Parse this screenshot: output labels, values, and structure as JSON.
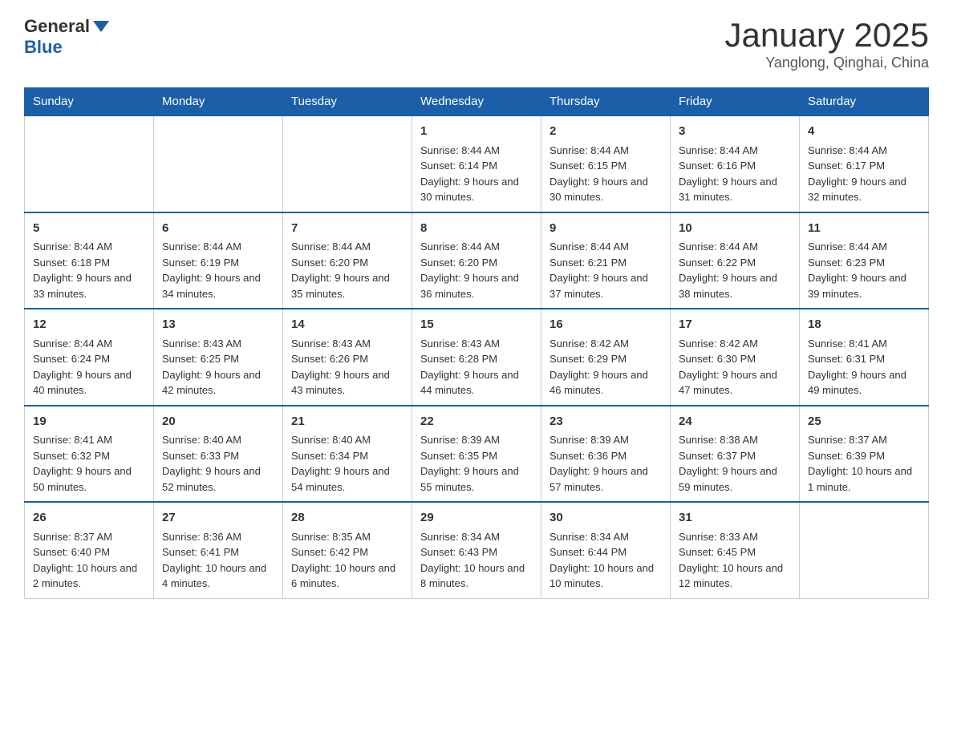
{
  "header": {
    "logo_general": "General",
    "logo_blue": "Blue",
    "month_title": "January 2025",
    "location": "Yanglong, Qinghai, China"
  },
  "weekdays": [
    "Sunday",
    "Monday",
    "Tuesday",
    "Wednesday",
    "Thursday",
    "Friday",
    "Saturday"
  ],
  "weeks": [
    [
      {
        "day": "",
        "info": ""
      },
      {
        "day": "",
        "info": ""
      },
      {
        "day": "",
        "info": ""
      },
      {
        "day": "1",
        "info": "Sunrise: 8:44 AM\nSunset: 6:14 PM\nDaylight: 9 hours and 30 minutes."
      },
      {
        "day": "2",
        "info": "Sunrise: 8:44 AM\nSunset: 6:15 PM\nDaylight: 9 hours and 30 minutes."
      },
      {
        "day": "3",
        "info": "Sunrise: 8:44 AM\nSunset: 6:16 PM\nDaylight: 9 hours and 31 minutes."
      },
      {
        "day": "4",
        "info": "Sunrise: 8:44 AM\nSunset: 6:17 PM\nDaylight: 9 hours and 32 minutes."
      }
    ],
    [
      {
        "day": "5",
        "info": "Sunrise: 8:44 AM\nSunset: 6:18 PM\nDaylight: 9 hours and 33 minutes."
      },
      {
        "day": "6",
        "info": "Sunrise: 8:44 AM\nSunset: 6:19 PM\nDaylight: 9 hours and 34 minutes."
      },
      {
        "day": "7",
        "info": "Sunrise: 8:44 AM\nSunset: 6:20 PM\nDaylight: 9 hours and 35 minutes."
      },
      {
        "day": "8",
        "info": "Sunrise: 8:44 AM\nSunset: 6:20 PM\nDaylight: 9 hours and 36 minutes."
      },
      {
        "day": "9",
        "info": "Sunrise: 8:44 AM\nSunset: 6:21 PM\nDaylight: 9 hours and 37 minutes."
      },
      {
        "day": "10",
        "info": "Sunrise: 8:44 AM\nSunset: 6:22 PM\nDaylight: 9 hours and 38 minutes."
      },
      {
        "day": "11",
        "info": "Sunrise: 8:44 AM\nSunset: 6:23 PM\nDaylight: 9 hours and 39 minutes."
      }
    ],
    [
      {
        "day": "12",
        "info": "Sunrise: 8:44 AM\nSunset: 6:24 PM\nDaylight: 9 hours and 40 minutes."
      },
      {
        "day": "13",
        "info": "Sunrise: 8:43 AM\nSunset: 6:25 PM\nDaylight: 9 hours and 42 minutes."
      },
      {
        "day": "14",
        "info": "Sunrise: 8:43 AM\nSunset: 6:26 PM\nDaylight: 9 hours and 43 minutes."
      },
      {
        "day": "15",
        "info": "Sunrise: 8:43 AM\nSunset: 6:28 PM\nDaylight: 9 hours and 44 minutes."
      },
      {
        "day": "16",
        "info": "Sunrise: 8:42 AM\nSunset: 6:29 PM\nDaylight: 9 hours and 46 minutes."
      },
      {
        "day": "17",
        "info": "Sunrise: 8:42 AM\nSunset: 6:30 PM\nDaylight: 9 hours and 47 minutes."
      },
      {
        "day": "18",
        "info": "Sunrise: 8:41 AM\nSunset: 6:31 PM\nDaylight: 9 hours and 49 minutes."
      }
    ],
    [
      {
        "day": "19",
        "info": "Sunrise: 8:41 AM\nSunset: 6:32 PM\nDaylight: 9 hours and 50 minutes."
      },
      {
        "day": "20",
        "info": "Sunrise: 8:40 AM\nSunset: 6:33 PM\nDaylight: 9 hours and 52 minutes."
      },
      {
        "day": "21",
        "info": "Sunrise: 8:40 AM\nSunset: 6:34 PM\nDaylight: 9 hours and 54 minutes."
      },
      {
        "day": "22",
        "info": "Sunrise: 8:39 AM\nSunset: 6:35 PM\nDaylight: 9 hours and 55 minutes."
      },
      {
        "day": "23",
        "info": "Sunrise: 8:39 AM\nSunset: 6:36 PM\nDaylight: 9 hours and 57 minutes."
      },
      {
        "day": "24",
        "info": "Sunrise: 8:38 AM\nSunset: 6:37 PM\nDaylight: 9 hours and 59 minutes."
      },
      {
        "day": "25",
        "info": "Sunrise: 8:37 AM\nSunset: 6:39 PM\nDaylight: 10 hours and 1 minute."
      }
    ],
    [
      {
        "day": "26",
        "info": "Sunrise: 8:37 AM\nSunset: 6:40 PM\nDaylight: 10 hours and 2 minutes."
      },
      {
        "day": "27",
        "info": "Sunrise: 8:36 AM\nSunset: 6:41 PM\nDaylight: 10 hours and 4 minutes."
      },
      {
        "day": "28",
        "info": "Sunrise: 8:35 AM\nSunset: 6:42 PM\nDaylight: 10 hours and 6 minutes."
      },
      {
        "day": "29",
        "info": "Sunrise: 8:34 AM\nSunset: 6:43 PM\nDaylight: 10 hours and 8 minutes."
      },
      {
        "day": "30",
        "info": "Sunrise: 8:34 AM\nSunset: 6:44 PM\nDaylight: 10 hours and 10 minutes."
      },
      {
        "day": "31",
        "info": "Sunrise: 8:33 AM\nSunset: 6:45 PM\nDaylight: 10 hours and 12 minutes."
      },
      {
        "day": "",
        "info": ""
      }
    ]
  ]
}
